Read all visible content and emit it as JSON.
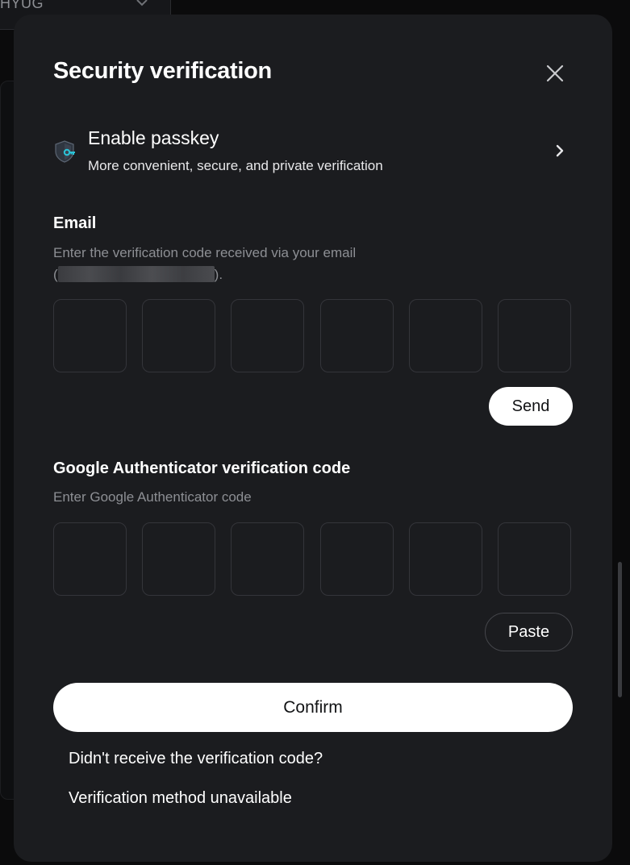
{
  "background": {
    "top_selector_text": "HYUG"
  },
  "modal": {
    "title": "Security verification",
    "passkey": {
      "title": "Enable passkey",
      "subtitle": "More convenient, secure, and private verification"
    },
    "email": {
      "label": "Email",
      "hint_line1": "Enter the verification code received via your email",
      "hint_open": "(",
      "hint_close": ").",
      "send_label": "Send",
      "digits": [
        "",
        "",
        "",
        "",
        "",
        ""
      ]
    },
    "google_auth": {
      "label": "Google Authenticator verification code",
      "hint": "Enter Google Authenticator code",
      "paste_label": "Paste",
      "digits": [
        "",
        "",
        "",
        "",
        "",
        ""
      ]
    },
    "confirm_label": "Confirm",
    "links": {
      "no_code": "Didn't receive the verification code?",
      "method_unavailable": "Verification method unavailable"
    }
  },
  "colors": {
    "page_bg": "#0b0b0c",
    "modal_bg": "#1b1c1f",
    "hint_text": "#8d8f94",
    "box_border": "#34353a",
    "primary_button": "#ffffff",
    "passkey_accent": "#2bc4d8"
  },
  "icons": {
    "close": "close-icon",
    "passkey": "passkey-shield-icon",
    "chevron": "chevron-right-icon",
    "dropdown": "chevron-down-icon"
  }
}
